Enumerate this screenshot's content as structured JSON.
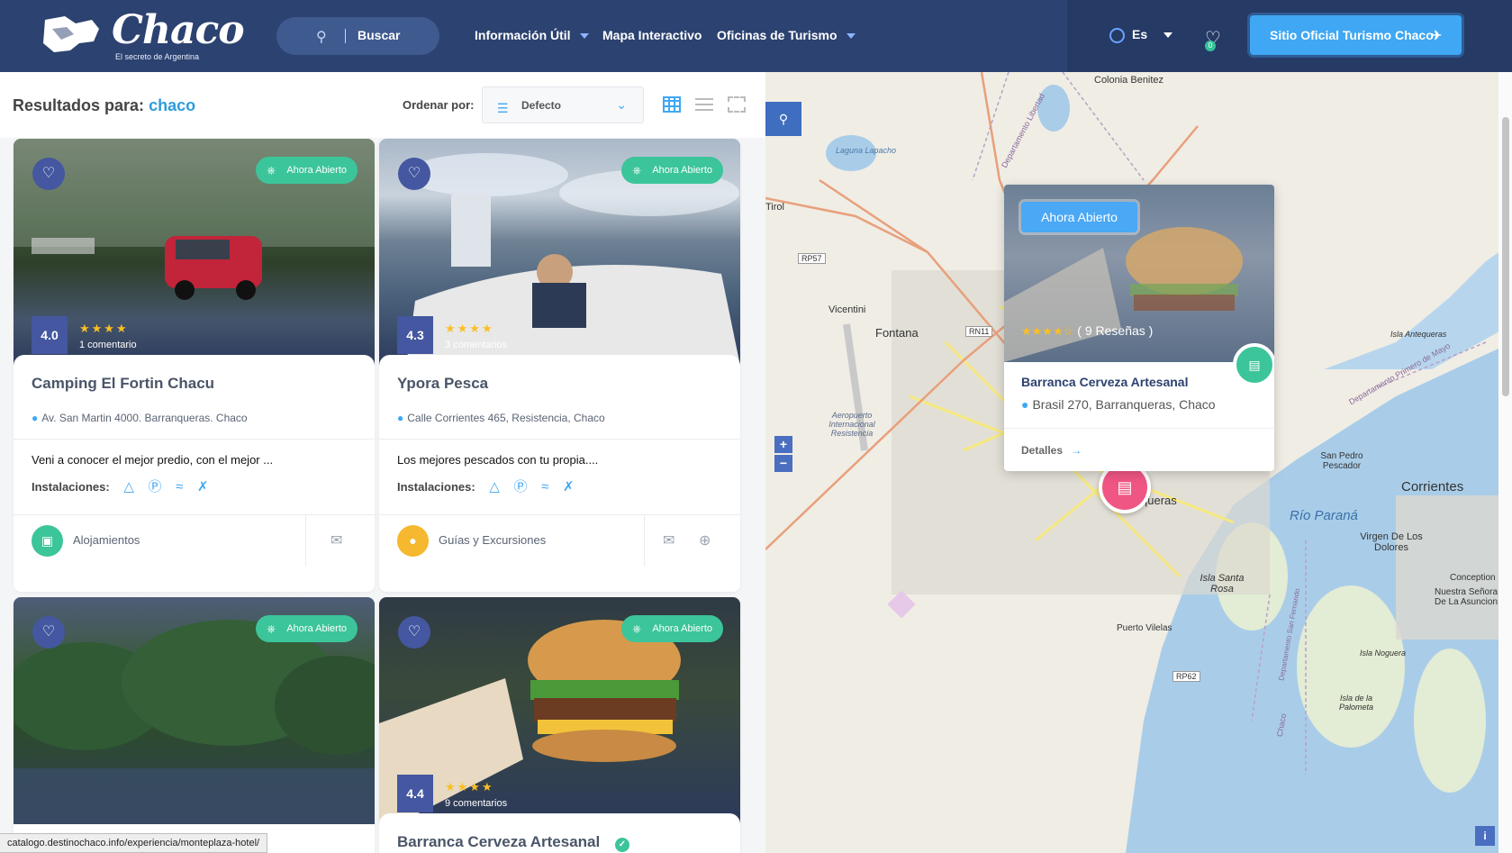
{
  "header": {
    "logo_text": "Chaco",
    "logo_tagline": "El secreto de Argentina",
    "search_label": "Buscar",
    "nav": [
      {
        "label": "Información Útil",
        "has_dropdown": true
      },
      {
        "label": "Mapa Interactivo",
        "has_dropdown": false
      },
      {
        "label": "Oficinas de Turismo",
        "has_dropdown": true
      }
    ],
    "language": "Es",
    "wishlist_count": "0",
    "official_site_button": "Sitio Oficial Turismo Chaco"
  },
  "toolbar": {
    "results_prefix": "Resultados para:",
    "query": "chaco",
    "order_label": "Ordenar por:",
    "order_value": "Defecto"
  },
  "cards": [
    {
      "badge": "Ahora Abierto",
      "rating": "4.0",
      "stars": "★★★★",
      "comments": "1 comentario",
      "title": "Camping El Fortin Chacu",
      "address": "Av. San Martin 4000. Barranqueras. Chaco",
      "description": "Veni a conocer el mejor predio, con el mejor ...",
      "facilities_label": "Instalaciones:",
      "category": "Alojamientos",
      "category_color": "#3cc59a"
    },
    {
      "badge": "Ahora Abierto",
      "rating": "4.3",
      "stars": "★★★★",
      "comments": "3 comentarios",
      "title": "Ypora Pesca",
      "address": "Calle Corrientes 465, Resistencia, Chaco",
      "description": "Los mejores pescados con tu propia....",
      "facilities_label": "Instalaciones:",
      "category": "Guías y Excursiones",
      "category_color": "#f5b82e"
    },
    {
      "badge": "Ahora Abierto"
    },
    {
      "badge": "Ahora Abierto",
      "rating": "4.4",
      "stars": "★★★★",
      "comments": "9 comentarios",
      "title": "Barranca Cerveza Artesanal"
    }
  ],
  "status_url": "catalogo.destinochaco.info/experiencia/monteplaza-hotel/",
  "map": {
    "zoom_in": "+",
    "zoom_out": "−",
    "labels": [
      "Colonia Benitez",
      "Laguna Lapacho",
      "Tirol",
      "RP57",
      "Vicentini",
      "Fontana",
      "RN11",
      "Aeropuerto Internacional Resistencia",
      "Isla Antequeras",
      "Corrientes",
      "Río Paraná",
      "San Pedro Pescador",
      "Virgen De Los Dolores",
      "Isla Santa Rosa",
      "Puerto Vilelas",
      "RP62",
      "Isla Noguera",
      "Isla de la Palometa",
      "Conception",
      "Nuestra Señora De La Asuncion",
      "Departamento Libertad",
      "Departamento San Fernando",
      "Departamento Primero de Mayo",
      "Chaco",
      "Barranqueras"
    ],
    "popup": {
      "badge": "Ahora Abierto",
      "stars": "★★★★☆",
      "reviews": "( 9 Reseñas )",
      "title": "Barranca Cerveza Artesanal",
      "address": "Brasil 270, Barranqueras, Chaco",
      "details": "Detalles"
    }
  },
  "colors": {
    "header_bg": "#2c4270",
    "accent_blue": "#3fa7f3",
    "open_green": "#3cc59a",
    "rating_box": "#4457a0",
    "marker_pink": "#f05683"
  }
}
